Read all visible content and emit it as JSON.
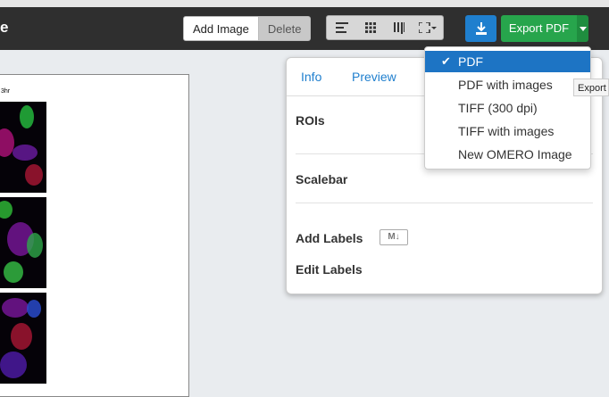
{
  "toolbar": {
    "brand": "e",
    "add_image": "Add Image",
    "delete": "Delete",
    "align_icon": "align-left-icon",
    "grid_icon": "grid-icon",
    "columns_icon": "columns-icon",
    "fullscreen_icon": "expand-icon",
    "download_icon": "download-icon",
    "export_label": "Export PDF"
  },
  "canvas": {
    "label": "3hr"
  },
  "side_panel": {
    "tabs": [
      "Info",
      "Preview"
    ],
    "sections": {
      "rois": "ROIs",
      "scalebar": "Scalebar",
      "add_labels": "Add Labels",
      "markdown_badge": "M↓",
      "edit_labels": "Edit Labels"
    }
  },
  "export_menu": {
    "selected_check": "✔",
    "items": [
      "PDF",
      "PDF with images",
      "TIFF (300 dpi)",
      "TIFF with images",
      "New OMERO Image"
    ]
  },
  "tooltip": "Export",
  "colors": {
    "primary": "#1f7fce",
    "success": "#27a54c",
    "toolbar": "#2f2f2f"
  }
}
